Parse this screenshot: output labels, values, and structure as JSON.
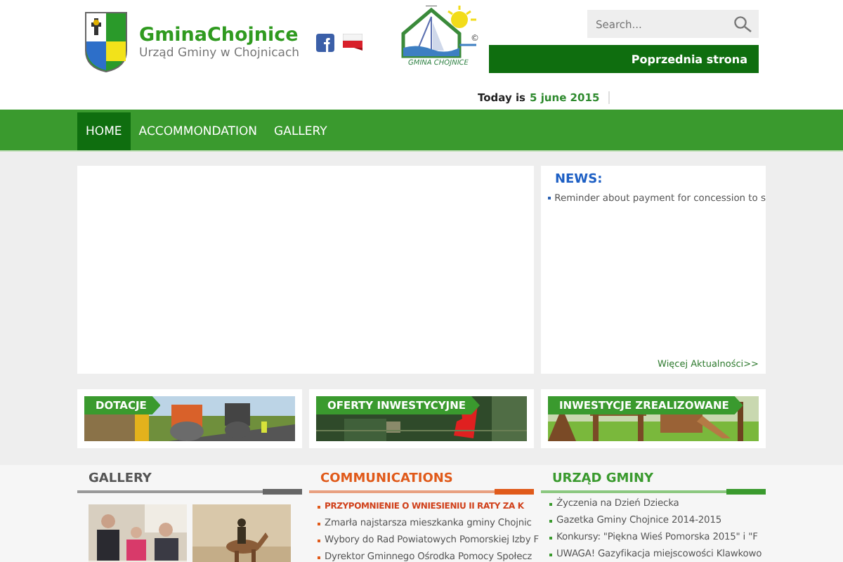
{
  "header": {
    "site_name": "GminaChojnice",
    "site_subtitle": "Urząd Gminy w Chojnicach",
    "logo_caption": "GMINA CHOJNICE",
    "logo_mark": "©",
    "search": {
      "placeholder": "Search..."
    },
    "back_link": "Poprzednia strona",
    "date_label": "Today is",
    "date": "5 june 2015"
  },
  "nav": [
    {
      "label": "HOME",
      "selected": true
    },
    {
      "label": "ACCOMMONDATION",
      "selected": false
    },
    {
      "label": "GALLERY",
      "selected": false
    }
  ],
  "news": {
    "title": "NEWS:",
    "items": [
      "Reminder about payment for concession to s"
    ],
    "more_link": "Więcej Aktualności>>"
  },
  "banners": [
    {
      "label": "DOTACJE",
      "kind": "road"
    },
    {
      "label": "OFERTY INWESTYCYJNE",
      "kind": "map"
    },
    {
      "label": "INWESTYCJE ZREALIZOWANE",
      "kind": "playground"
    }
  ],
  "gallery": {
    "title": "GALLERY"
  },
  "communications": {
    "title": "COMMUNICATIONS",
    "items": [
      {
        "text": "PRZYPOMNIENIE O WNIESIENIU II RATY ZA K",
        "highlighted": true
      },
      {
        "text": "Zmarła najstarsza mieszkanka gminy Chojnic",
        "highlighted": false
      },
      {
        "text": "Wybory do Rad Powiatowych Pomorskiej Izby F",
        "highlighted": false
      },
      {
        "text": "Dyrektor Gminnego Ośrodka Pomocy Społecz",
        "highlighted": false
      }
    ]
  },
  "office": {
    "title": "URZĄD GMINY",
    "items": [
      {
        "text": "Życzenia na Dzień Dziecka",
        "highlighted": false
      },
      {
        "text": "Gazetka Gminy Chojnice 2014-2015",
        "highlighted": false
      },
      {
        "text": "Konkursy: \"Piękna Wieś Pomorska 2015\" i \"F",
        "highlighted": false
      },
      {
        "text": "UWAGA! Gazyfikacja miejscowości Klawkowo",
        "highlighted": false
      }
    ]
  }
}
